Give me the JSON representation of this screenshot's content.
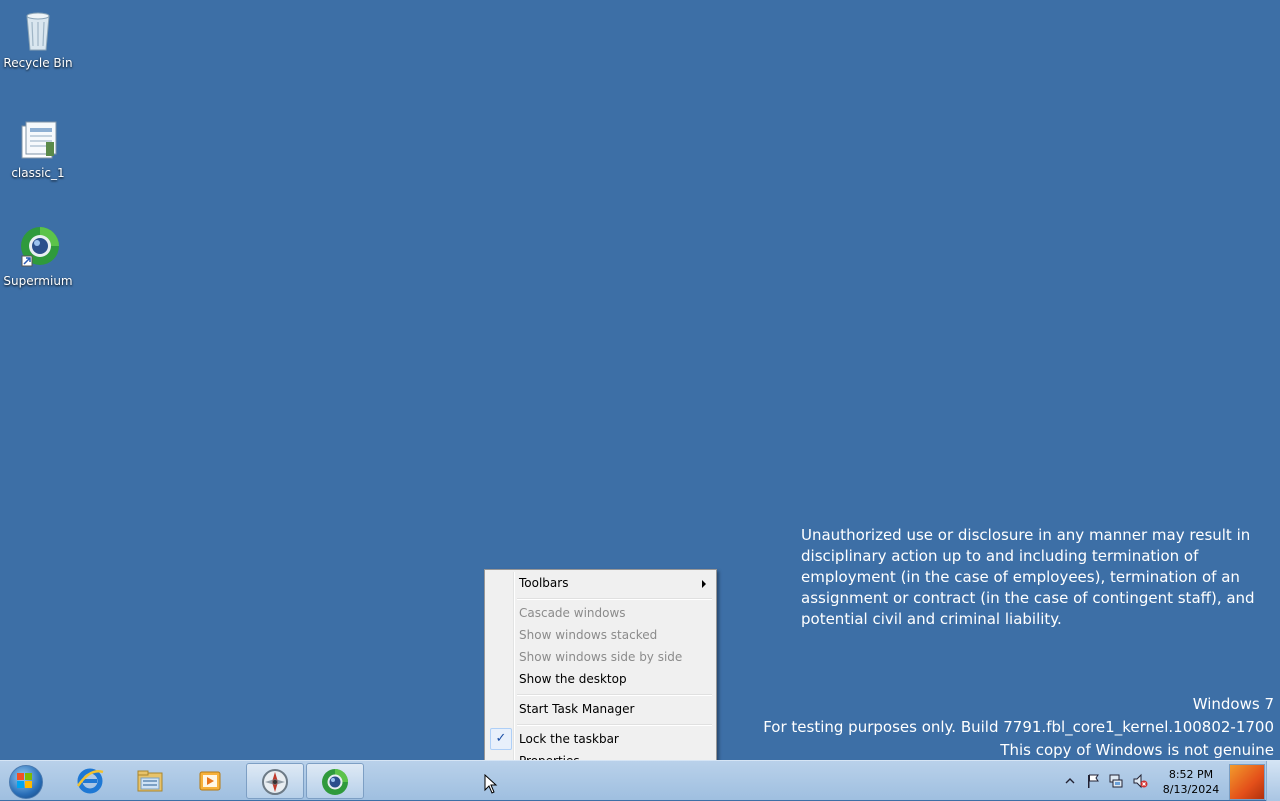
{
  "desktop": {
    "icons": [
      {
        "label": "Recycle Bin",
        "icon": "recycle-bin-icon"
      },
      {
        "label": "classic_1",
        "icon": "document-icon"
      },
      {
        "label": "Supermium",
        "icon": "supermium-browser-icon"
      }
    ],
    "notice": "Unauthorized use or disclosure in any manner may result in disciplinary action up to and including termination of employment (in the case of employees), termination of an assignment or contract (in the case of contingent staff), and potential civil and criminal liability.",
    "watermark": {
      "line1": "Windows 7",
      "line2": "For testing purposes only. Build 7791.fbl_core1_kernel.100802-1700",
      "line3": "This copy of Windows is not genuine"
    }
  },
  "context_menu": {
    "items": [
      {
        "label": "Toolbars",
        "enabled": true,
        "submenu": true
      },
      {
        "label": "Cascade windows",
        "enabled": false
      },
      {
        "label": "Show windows stacked",
        "enabled": false
      },
      {
        "label": "Show windows side by side",
        "enabled": false
      },
      {
        "label": "Show the desktop",
        "enabled": true
      },
      {
        "label": "Start Task Manager",
        "enabled": true
      },
      {
        "label": "Lock the taskbar",
        "enabled": true,
        "checked": true
      },
      {
        "label": "Properties",
        "enabled": true
      }
    ],
    "check_glyph": "✓"
  },
  "taskbar": {
    "pinned": [
      {
        "icon": "internet-explorer-icon",
        "active": false
      },
      {
        "icon": "file-explorer-icon",
        "active": false
      },
      {
        "icon": "media-player-icon",
        "active": false
      },
      {
        "icon": "compass-app-icon",
        "active": true
      },
      {
        "icon": "supermium-browser-icon",
        "active": true
      }
    ],
    "tray_icons": [
      "show-hidden-icons-icon",
      "action-center-flag-icon",
      "network-icon",
      "volume-muted-icon"
    ],
    "clock": {
      "time": "8:52 PM",
      "date": "8/13/2024"
    }
  },
  "colors": {
    "desktop_bg": "#3d6fa6",
    "taskbar_bg": "#b9d1ea",
    "menu_bg": "#f0f0f0"
  }
}
